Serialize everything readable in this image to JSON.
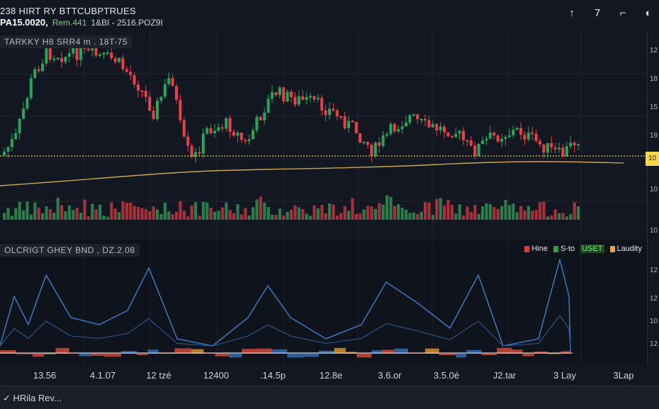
{
  "header": {
    "symbol_line": "238 HIRT RY BTTCUBPTRUES",
    "price": "PA15.0020,",
    "change": "Rem.441",
    "extra": "1&BI - 2516.POZ9I"
  },
  "toolbar": {
    "icons": [
      "arrow-up-icon",
      "seven-icon",
      "crop-icon",
      "contrast-icon"
    ],
    "labels": [
      "↑",
      "7",
      "⌐",
      "◐"
    ]
  },
  "main_pane": {
    "title": "TARKKY H8 SRR4 m . 18T-75"
  },
  "indicator_pane": {
    "title": "OLCRIGT GHEY BND   , DZ.2.08"
  },
  "legend": [
    {
      "label": "Hine",
      "color": "#e03b3b",
      "text_color": "#e6e8ee"
    },
    {
      "label": "S-to",
      "color": "#2ea043",
      "text_color": "#e6e8ee"
    },
    {
      "label": "USET",
      "color": "#1e7a2f",
      "text_color": "#69f06d"
    },
    {
      "label": "Laudity",
      "color": "#f0a030",
      "text_color": "#e6e8ee"
    }
  ],
  "x_axis": {
    "ticks": [
      "13.56",
      "4.1.07",
      "12 tzé",
      "12400",
      ".14.5p",
      "12.8e",
      "3.6.or",
      "3.5.0é",
      "J2.tar",
      "3 Lay",
      "3Lap"
    ]
  },
  "y_axis": {
    "ticks": [
      "12",
      "18",
      "15",
      "19",
      "10",
      "10",
      "12",
      "12",
      "10",
      "12"
    ]
  },
  "price_tag": "10",
  "footer": {
    "text": "✓ HRila Rev..."
  },
  "colors": {
    "up": "#26a65b",
    "down": "#e8404a",
    "ma": "#c9a64a",
    "ref_line": "#e8d23a",
    "osc": "#3b78c4"
  }
}
